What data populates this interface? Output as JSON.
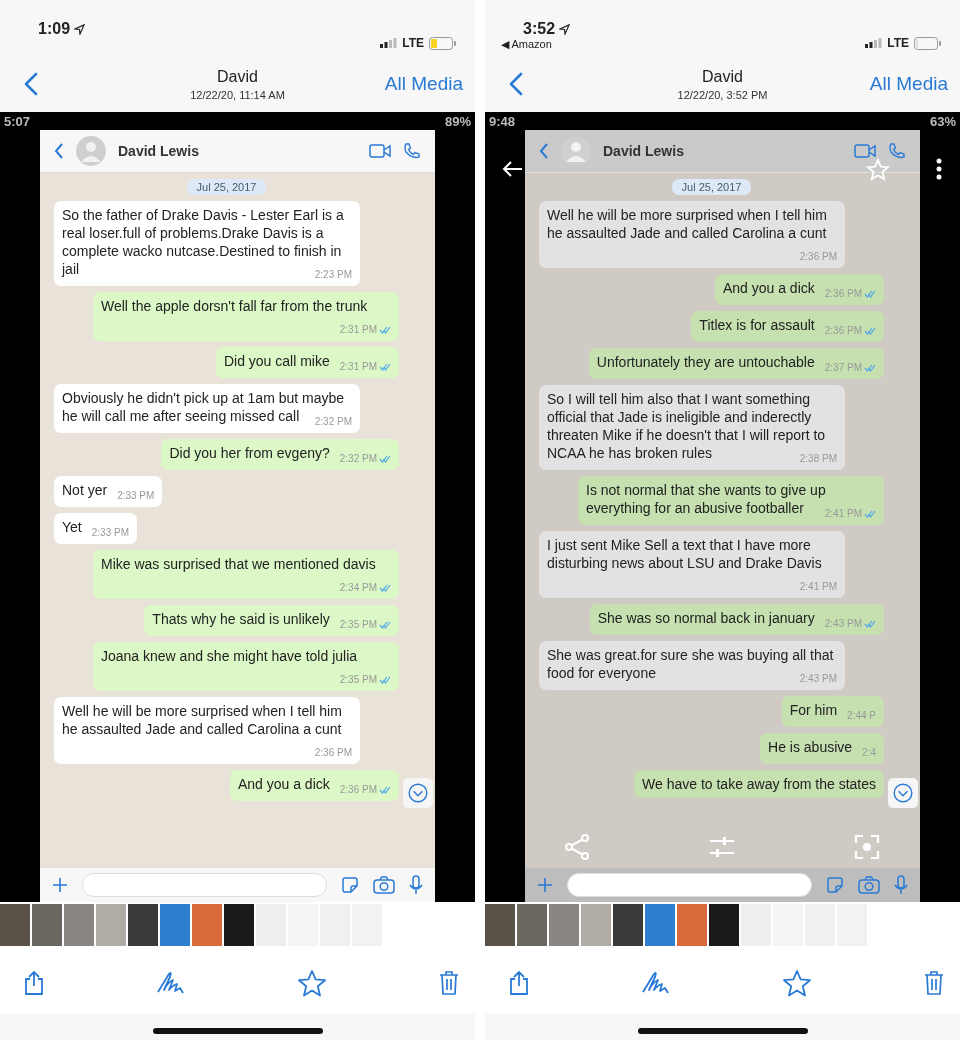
{
  "panels": [
    {
      "status_bar": {
        "time": "1:09",
        "network": "LTE",
        "low_power": true
      },
      "nav": {
        "title": "David",
        "subtitle": "12/22/20, 11:14 AM",
        "action": "All Media"
      },
      "photo": {
        "android_time": "5:07",
        "android_battery": "89%",
        "controls_shown": false,
        "chat": {
          "contact": "David Lewis",
          "date": "Jul 25, 2017",
          "messages": [
            {
              "kind": "in",
              "text": "So the father of Drake Davis - Lester Earl is a real loser.full of problems.Drake Davis is a complete wacko nutcase.Destined to finish in jail",
              "time": "2:23 PM",
              "read": false
            },
            {
              "kind": "out",
              "text": "Well the apple dorsn't fall far from the trunk",
              "time": "2:31 PM",
              "read": true
            },
            {
              "kind": "out",
              "text": "Did you call mike",
              "time": "2:31 PM",
              "read": true
            },
            {
              "kind": "in",
              "text": "Obviously he didn't pick up at 1am but maybe he will call me after seeing missed call",
              "time": "2:32 PM",
              "read": false
            },
            {
              "kind": "out",
              "text": "Did you her from evgeny?",
              "time": "2:32 PM",
              "read": true
            },
            {
              "kind": "in",
              "text": "Not yer",
              "time": "2:33 PM",
              "read": false
            },
            {
              "kind": "in",
              "text": "Yet",
              "time": "2:33 PM",
              "read": false
            },
            {
              "kind": "out",
              "text": "Mike was surprised that we mentioned davis",
              "time": "2:34 PM",
              "read": true
            },
            {
              "kind": "out",
              "text": "Thats why he said is unlikely",
              "time": "2:35 PM",
              "read": true
            },
            {
              "kind": "out",
              "text": "Joana knew and she might have told julia",
              "time": "2:35 PM",
              "read": true
            },
            {
              "kind": "in",
              "text": "Well he will be more surprised when I tell him he assaulted Jade and called Carolina a cunt",
              "time": "2:36 PM",
              "read": false
            },
            {
              "kind": "out",
              "text": "And you a dick",
              "time": "2:36 PM",
              "read": true
            }
          ]
        }
      }
    },
    {
      "status_bar": {
        "time": "3:52",
        "back_app": "◀ Amazon",
        "network": "LTE",
        "low_power": false
      },
      "nav": {
        "title": "David",
        "subtitle": "12/22/20, 3:52 PM",
        "action": "All Media"
      },
      "photo": {
        "android_time": "9:48",
        "android_battery": "63%",
        "controls_shown": true,
        "chat": {
          "contact": "David Lewis",
          "date": "Jul 25, 2017",
          "messages": [
            {
              "kind": "in",
              "text": "Well he will be more surprised when I tell him he assaulted Jade and called Carolina a cunt",
              "time": "2:36 PM",
              "read": false
            },
            {
              "kind": "out",
              "text": "And you a dick",
              "time": "2:36 PM",
              "read": true
            },
            {
              "kind": "out",
              "text": "Titlex is for assault",
              "time": "2:36 PM",
              "read": true
            },
            {
              "kind": "out",
              "text": "Unfortunately they are untouchable",
              "time": "2:37 PM",
              "read": true
            },
            {
              "kind": "in",
              "text": "So I will tell him also that I want something official that Jade is ineligible and  inderectly threaten Mike if he doesn't that I will report to NCAA he has broken rules",
              "time": "2:38 PM",
              "read": false
            },
            {
              "kind": "out",
              "text": "Is not normal that she wants to give up everything for an abusive footballer",
              "time": "2:41 PM",
              "read": true
            },
            {
              "kind": "in",
              "text": "I just sent Mike Sell a text that I have more disturbing news about LSU and Drake Davis",
              "time": "2:41 PM",
              "read": false
            },
            {
              "kind": "out",
              "text": "She was so normal back in january",
              "time": "2:43 PM",
              "read": true
            },
            {
              "kind": "in",
              "text": "She was great.for sure she was buying all that food for everyone",
              "time": "2:43 PM",
              "read": false
            },
            {
              "kind": "out",
              "text": "For him",
              "time": "2:44 P",
              "read": false
            },
            {
              "kind": "out",
              "text": "He is abusive",
              "time": "2:4",
              "read": false
            },
            {
              "kind": "out",
              "text": "We have to take away from the states",
              "read": false
            }
          ]
        }
      }
    }
  ]
}
